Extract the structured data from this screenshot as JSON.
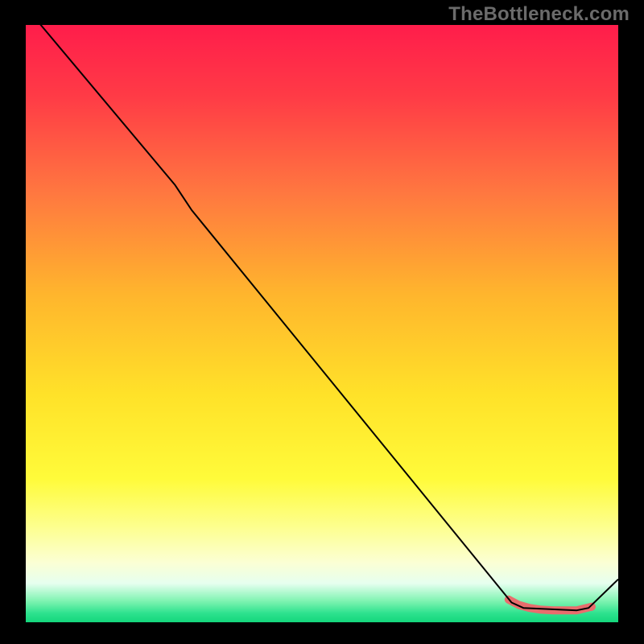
{
  "watermark": "TheBottleneck.com",
  "chart_data": {
    "type": "line",
    "title": "",
    "xlabel": "",
    "ylabel": "",
    "xlim": [
      0,
      100
    ],
    "ylim": [
      0,
      100
    ],
    "grid": false,
    "legend": false,
    "background": {
      "type": "vertical-gradient",
      "stops": [
        {
          "offset": 0.0,
          "color": "#ff1d4b"
        },
        {
          "offset": 0.12,
          "color": "#ff3b46"
        },
        {
          "offset": 0.28,
          "color": "#ff7740"
        },
        {
          "offset": 0.45,
          "color": "#ffb52d"
        },
        {
          "offset": 0.62,
          "color": "#ffe229"
        },
        {
          "offset": 0.76,
          "color": "#fffb3a"
        },
        {
          "offset": 0.84,
          "color": "#fdff8e"
        },
        {
          "offset": 0.9,
          "color": "#fbffd4"
        },
        {
          "offset": 0.935,
          "color": "#e6ffef"
        },
        {
          "offset": 0.965,
          "color": "#7df3b0"
        },
        {
          "offset": 0.985,
          "color": "#2de28e"
        },
        {
          "offset": 1.0,
          "color": "#14d67c"
        }
      ]
    },
    "series": [
      {
        "name": "bottleneck-curve",
        "color": "#000000",
        "width": 2,
        "points": [
          {
            "x": 0.0,
            "y": 103.0
          },
          {
            "x": 25.2,
            "y": 73.2
          },
          {
            "x": 28.0,
            "y": 69.0
          },
          {
            "x": 82.0,
            "y": 3.3
          },
          {
            "x": 84.0,
            "y": 2.4
          },
          {
            "x": 93.0,
            "y": 2.0
          },
          {
            "x": 95.0,
            "y": 2.4
          },
          {
            "x": 100.0,
            "y": 7.2
          }
        ]
      }
    ],
    "markers": [
      {
        "name": "flat-region-highlight",
        "color": "#e86d6d",
        "points": [
          {
            "x": 81.5,
            "y": 3.8
          },
          {
            "x": 83.2,
            "y": 2.9
          },
          {
            "x": 85.0,
            "y": 2.4
          },
          {
            "x": 87.0,
            "y": 2.1
          },
          {
            "x": 89.0,
            "y": 2.0
          },
          {
            "x": 91.0,
            "y": 2.0
          },
          {
            "x": 93.0,
            "y": 2.0
          },
          {
            "x": 95.5,
            "y": 2.6
          }
        ],
        "radius": 5
      }
    ]
  }
}
